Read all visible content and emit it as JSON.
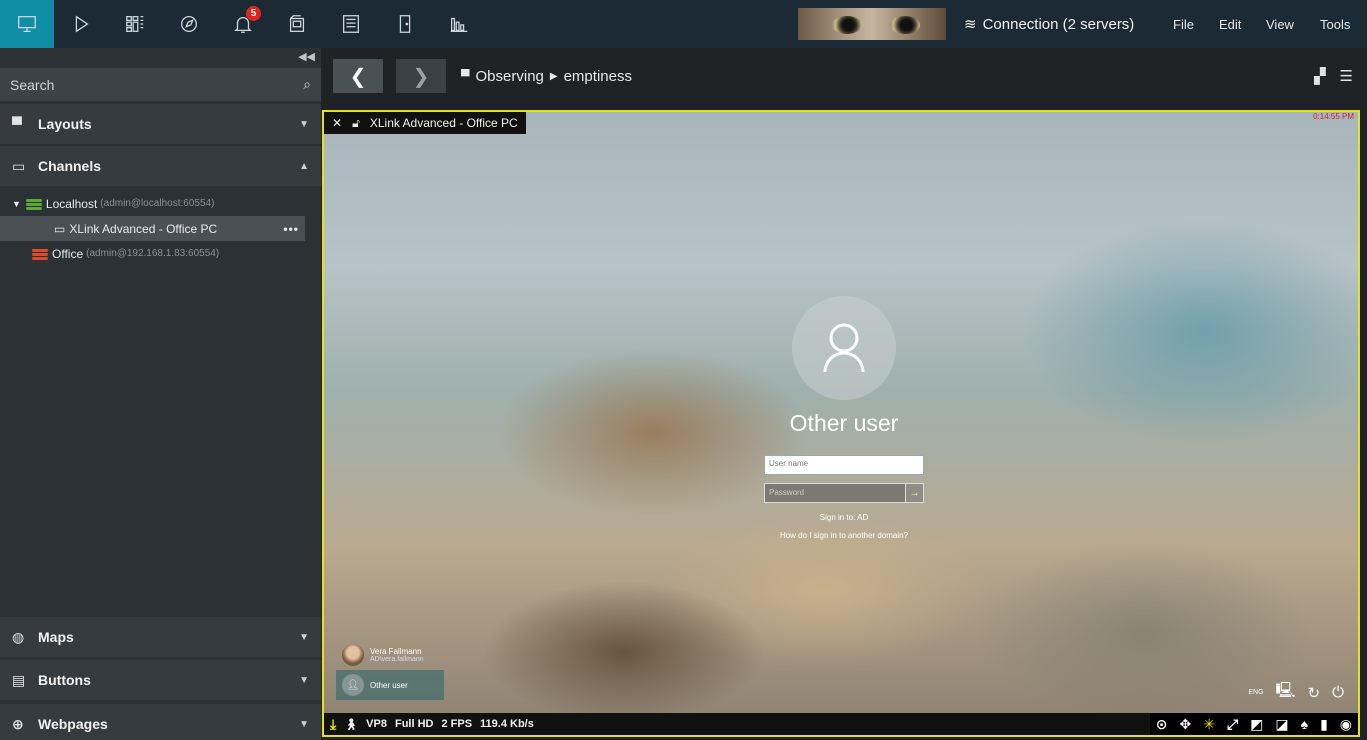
{
  "topbar": {
    "notifications_count": "5",
    "connection_label": "Connection (2 servers)",
    "menu": [
      "File",
      "Edit",
      "View",
      "Tools"
    ]
  },
  "sidebar": {
    "search_placeholder": "Search",
    "sections": {
      "layouts": "Layouts",
      "channels": "Channels",
      "maps": "Maps",
      "buttons": "Buttons",
      "webpages": "Webpages"
    },
    "tree": {
      "localhost": {
        "name": "Localhost",
        "detail": "(admin@localhost:60554)"
      },
      "channel": {
        "name": "XLink Advanced - Office PC",
        "more": "•••"
      },
      "office": {
        "name": "Office",
        "detail": "(admin@192.168.1.83:60554)"
      }
    }
  },
  "header": {
    "breadcrumb_root": "Observing",
    "breadcrumb_leaf": "emptiness"
  },
  "video": {
    "title": "XLink Advanced - Office PC",
    "timestamp": "0:14:55 PM",
    "login": {
      "heading": "Other user",
      "username_placeholder": "User name",
      "password_placeholder": "Password",
      "sign_in_to": "Sign in to: AD",
      "other_domain": "How do I sign in to another domain?"
    },
    "users": [
      {
        "name": "Vera Fallmann",
        "account": "AD\\vera.fallmann"
      },
      {
        "name": "Other user"
      }
    ],
    "language": "ENG",
    "status": {
      "codec": "VP8",
      "resolution": "Full HD",
      "fps": "2 FPS",
      "bitrate": "119.4 Kb/s"
    }
  },
  "colors": {
    "accent": "#0f8ea6",
    "selection_border": "#e6e21a",
    "badge": "#e02424",
    "localhost_server": "#5fa83a",
    "office_server": "#e0482c"
  }
}
